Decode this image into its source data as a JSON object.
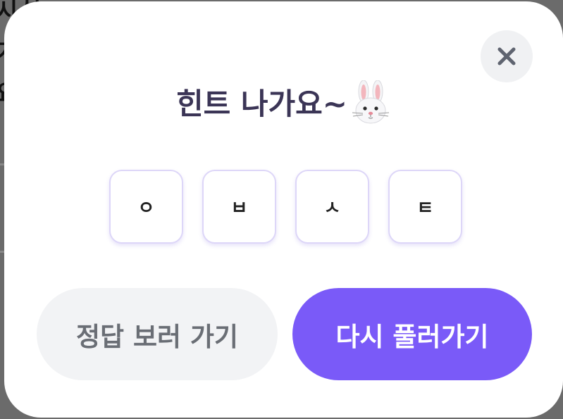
{
  "modal": {
    "title": "힌트 나가요~",
    "title_emoji": "rabbit-face",
    "close_icon": "close-icon"
  },
  "hint_tiles": [
    "ㅇ",
    "ㅂ",
    "ㅅ",
    "ㅌ"
  ],
  "buttons": {
    "view_answer_label": "정답 보러 가기",
    "retry_label": "다시 풀러가기"
  },
  "colors": {
    "primary": "#7a5af8",
    "title": "#3b3556",
    "secondary_button_bg": "#f2f3f5",
    "secondary_button_text": "#6a6e75",
    "tile_border": "#ddd6f8"
  }
}
